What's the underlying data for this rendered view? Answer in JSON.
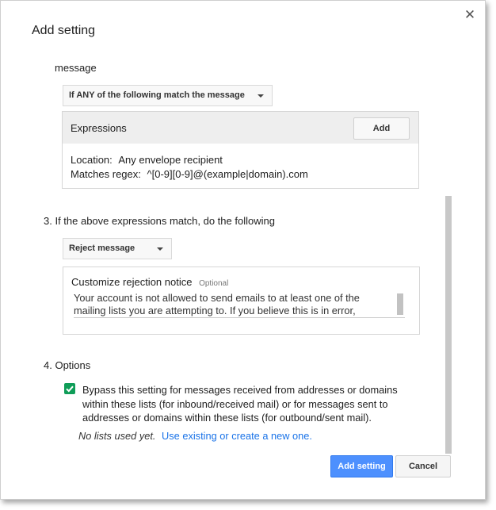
{
  "dialog": {
    "title": "Add setting",
    "close_glyph": "✕"
  },
  "section_top": {
    "label": "message"
  },
  "match_dropdown": {
    "value": "If ANY of the following match the message"
  },
  "expressions": {
    "header": "Expressions",
    "add_label": "Add",
    "location_label": "Location:",
    "location_value": "Any envelope recipient",
    "regex_label": "Matches regex:",
    "regex_value": "^[0-9][0-9]@(example|domain).com"
  },
  "step3": {
    "label": "3. If the above expressions match, do the following",
    "action_value": "Reject message",
    "notice_label": "Customize rejection notice",
    "notice_optional": "Optional",
    "notice_line1": "Your account is not allowed to send emails to at least one of the",
    "notice_line2": "mailing lists you are attempting to. If you believe this is in error,"
  },
  "step4": {
    "label": "4. Options",
    "bypass_line1": "Bypass this setting for messages received from addresses or domains",
    "bypass_line2": "within these lists (for inbound/received mail) or for messages sent to",
    "bypass_line3": "addresses or domains within these lists (for outbound/sent mail).",
    "bypass_checked": true,
    "no_lists": "No lists used yet.",
    "link": "Use existing or create a new one."
  },
  "footer": {
    "primary_label": "Add setting",
    "cancel_label": "Cancel"
  },
  "colors": {
    "accent": "#4d90fe",
    "checkbox": "#0f9d58",
    "link": "#1a73e8"
  }
}
